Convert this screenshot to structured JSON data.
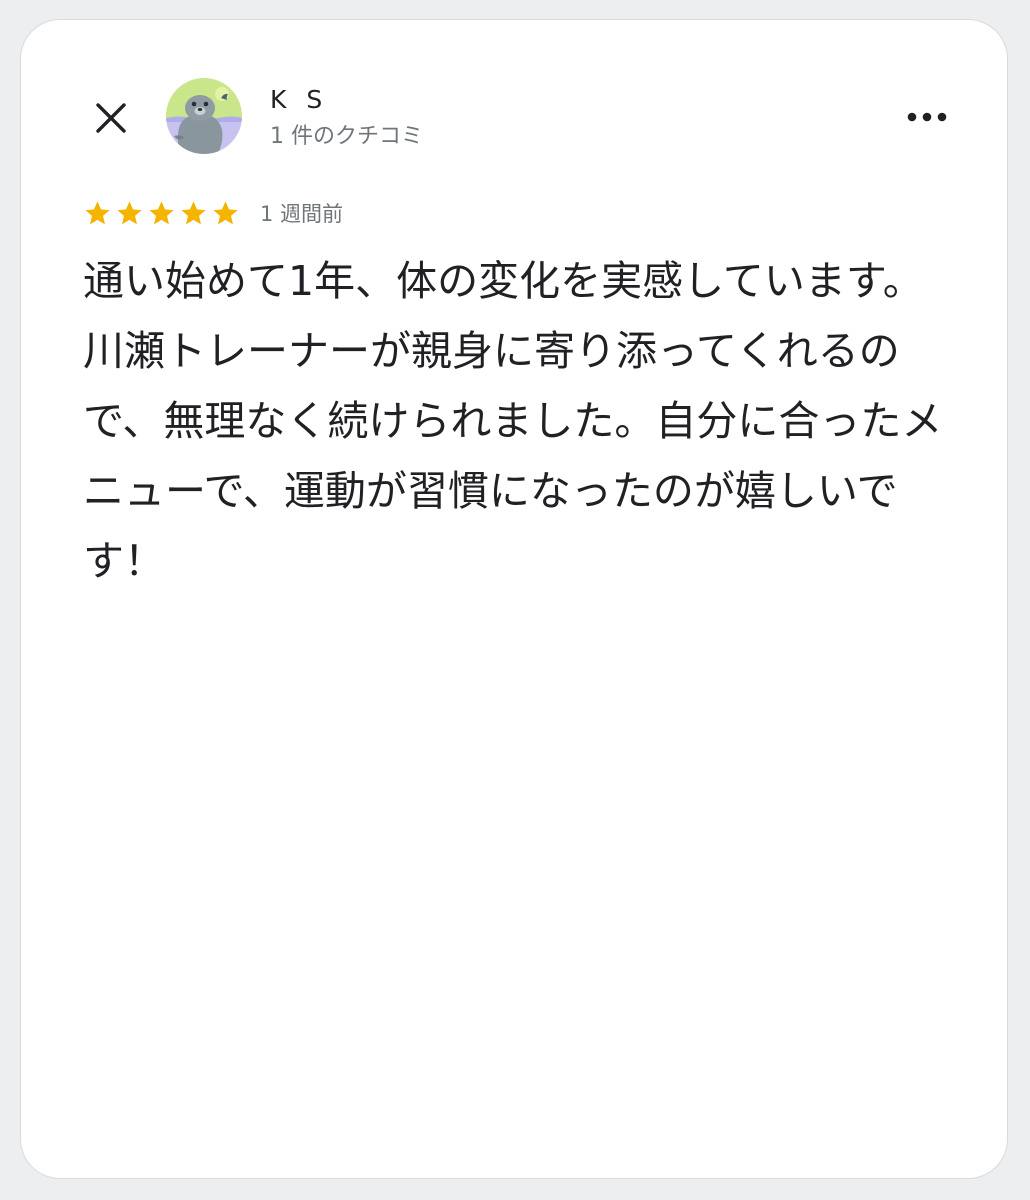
{
  "reviewer": {
    "name": "K S",
    "review_count": "1 件のクチコミ"
  },
  "icons": {
    "close": "close-icon",
    "more": "more-horiz-icon",
    "avatar": "seal-avatar",
    "star": "star-icon"
  },
  "review": {
    "rating": 5,
    "rating_max": 5,
    "date": "1 週間前",
    "text": "通い始めて1年、体の変化を実感しています。\n川瀬トレーナーが親身に寄り添ってくれるので、無理なく続けられました。自分に合ったメニューで、運動が習慣になったのが嬉しいです！"
  },
  "colors": {
    "star": "#f4b400",
    "text_primary": "#202124",
    "text_secondary": "#70757a",
    "card_background": "#ffffff"
  }
}
